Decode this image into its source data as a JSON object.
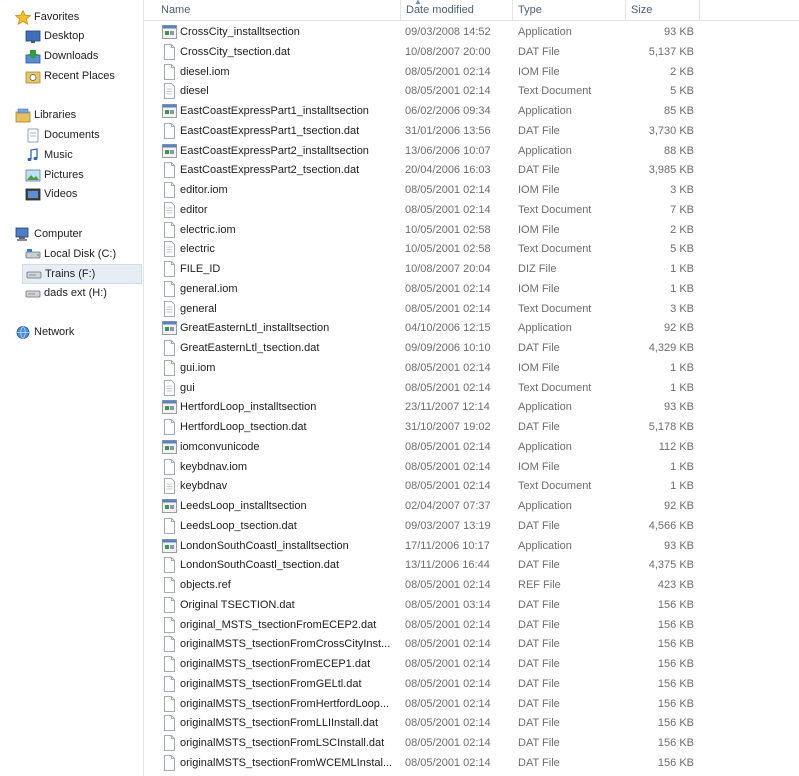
{
  "nav": {
    "favorites": "Favorites",
    "desktop": "Desktop",
    "downloads": "Downloads",
    "recent_places": "Recent Places",
    "libraries": "Libraries",
    "documents": "Documents",
    "music": "Music",
    "pictures": "Pictures",
    "videos": "Videos",
    "computer": "Computer",
    "local_disk": "Local Disk (C:)",
    "trains": "Trains (F:)",
    "dads_ext": "dads ext (H:)",
    "network": "Network"
  },
  "columns": {
    "name": "Name",
    "date": "Date modified",
    "type": "Type",
    "size": "Size"
  },
  "colors": {
    "selected_bg": "#e6edf5",
    "header_text": "#4c607a",
    "meta_text": "#6d6d6d"
  },
  "files": [
    {
      "name": "CrossCity_installtsection",
      "date": "09/03/2008 14:52",
      "type": "Application",
      "size": "93 KB",
      "icon": "application-icon"
    },
    {
      "name": "CrossCity_tsection.dat",
      "date": "10/08/2007 20:00",
      "type": "DAT File",
      "size": "5,137 KB",
      "icon": "file-icon"
    },
    {
      "name": "diesel.iom",
      "date": "08/05/2001 02:14",
      "type": "IOM File",
      "size": "2 KB",
      "icon": "file-icon"
    },
    {
      "name": "diesel",
      "date": "08/05/2001 02:14",
      "type": "Text Document",
      "size": "5 KB",
      "icon": "text-document-icon"
    },
    {
      "name": "EastCoastExpressPart1_installtsection",
      "date": "06/02/2006 09:34",
      "type": "Application",
      "size": "85 KB",
      "icon": "application-icon"
    },
    {
      "name": "EastCoastExpressPart1_tsection.dat",
      "date": "31/01/2006 13:56",
      "type": "DAT File",
      "size": "3,730 KB",
      "icon": "file-icon"
    },
    {
      "name": "EastCoastExpressPart2_installtsection",
      "date": "13/06/2006 10:07",
      "type": "Application",
      "size": "88 KB",
      "icon": "application-icon"
    },
    {
      "name": "EastCoastExpressPart2_tsection.dat",
      "date": "20/04/2006 16:03",
      "type": "DAT File",
      "size": "3,985 KB",
      "icon": "file-icon"
    },
    {
      "name": "editor.iom",
      "date": "08/05/2001 02:14",
      "type": "IOM File",
      "size": "3 KB",
      "icon": "file-icon"
    },
    {
      "name": "editor",
      "date": "08/05/2001 02:14",
      "type": "Text Document",
      "size": "7 KB",
      "icon": "text-document-icon"
    },
    {
      "name": "electric.iom",
      "date": "10/05/2001 02:58",
      "type": "IOM File",
      "size": "2 KB",
      "icon": "file-icon"
    },
    {
      "name": "electric",
      "date": "10/05/2001 02:58",
      "type": "Text Document",
      "size": "5 KB",
      "icon": "text-document-icon"
    },
    {
      "name": "FILE_ID",
      "date": "10/08/2007 20:04",
      "type": "DIZ File",
      "size": "1 KB",
      "icon": "file-icon"
    },
    {
      "name": "general.iom",
      "date": "08/05/2001 02:14",
      "type": "IOM File",
      "size": "1 KB",
      "icon": "file-icon"
    },
    {
      "name": "general",
      "date": "08/05/2001 02:14",
      "type": "Text Document",
      "size": "3 KB",
      "icon": "text-document-icon"
    },
    {
      "name": "GreatEasternLtl_installtsection",
      "date": "04/10/2006 12:15",
      "type": "Application",
      "size": "92 KB",
      "icon": "application-icon"
    },
    {
      "name": "GreatEasternLtl_tsection.dat",
      "date": "09/09/2006 10:10",
      "type": "DAT File",
      "size": "4,329 KB",
      "icon": "file-icon"
    },
    {
      "name": "gui.iom",
      "date": "08/05/2001 02:14",
      "type": "IOM File",
      "size": "1 KB",
      "icon": "file-icon"
    },
    {
      "name": "gui",
      "date": "08/05/2001 02:14",
      "type": "Text Document",
      "size": "1 KB",
      "icon": "text-document-icon"
    },
    {
      "name": "HertfordLoop_installtsection",
      "date": "23/11/2007 12:14",
      "type": "Application",
      "size": "93 KB",
      "icon": "application-icon"
    },
    {
      "name": "HertfordLoop_tsection.dat",
      "date": "31/10/2007 19:02",
      "type": "DAT File",
      "size": "5,178 KB",
      "icon": "file-icon"
    },
    {
      "name": "iomconvunicode",
      "date": "08/05/2001 02:14",
      "type": "Application",
      "size": "112 KB",
      "icon": "application-icon"
    },
    {
      "name": "keybdnav.iom",
      "date": "08/05/2001 02:14",
      "type": "IOM File",
      "size": "1 KB",
      "icon": "file-icon"
    },
    {
      "name": "keybdnav",
      "date": "08/05/2001 02:14",
      "type": "Text Document",
      "size": "1 KB",
      "icon": "text-document-icon"
    },
    {
      "name": "LeedsLoop_installtsection",
      "date": "02/04/2007 07:37",
      "type": "Application",
      "size": "92 KB",
      "icon": "application-icon"
    },
    {
      "name": "LeedsLoop_tsection.dat",
      "date": "09/03/2007 13:19",
      "type": "DAT File",
      "size": "4,566 KB",
      "icon": "file-icon"
    },
    {
      "name": "LondonSouthCoastl_installtsection",
      "date": "17/11/2006 10:17",
      "type": "Application",
      "size": "93 KB",
      "icon": "application-icon"
    },
    {
      "name": "LondonSouthCoastl_tsection.dat",
      "date": "13/11/2006 16:44",
      "type": "DAT File",
      "size": "4,375 KB",
      "icon": "file-icon"
    },
    {
      "name": "objects.ref",
      "date": "08/05/2001 02:14",
      "type": "REF File",
      "size": "423 KB",
      "icon": "file-icon"
    },
    {
      "name": "Original TSECTION.dat",
      "date": "08/05/2001 03:14",
      "type": "DAT File",
      "size": "156 KB",
      "icon": "file-icon"
    },
    {
      "name": "original_MSTS_tsectionFromECEP2.dat",
      "date": "08/05/2001 02:14",
      "type": "DAT File",
      "size": "156 KB",
      "icon": "file-icon"
    },
    {
      "name": "originalMSTS_tsectionFromCrossCityInst...",
      "date": "08/05/2001 02:14",
      "type": "DAT File",
      "size": "156 KB",
      "icon": "file-icon"
    },
    {
      "name": "originalMSTS_tsectionFromECEP1.dat",
      "date": "08/05/2001 02:14",
      "type": "DAT File",
      "size": "156 KB",
      "icon": "file-icon"
    },
    {
      "name": "originalMSTS_tsectionFromGELtl.dat",
      "date": "08/05/2001 02:14",
      "type": "DAT File",
      "size": "156 KB",
      "icon": "file-icon"
    },
    {
      "name": "originalMSTS_tsectionFromHertfordLoop...",
      "date": "08/05/2001 02:14",
      "type": "DAT File",
      "size": "156 KB",
      "icon": "file-icon"
    },
    {
      "name": "originalMSTS_tsectionFromLLIInstall.dat",
      "date": "08/05/2001 02:14",
      "type": "DAT File",
      "size": "156 KB",
      "icon": "file-icon"
    },
    {
      "name": "originalMSTS_tsectionFromLSCInstall.dat",
      "date": "08/05/2001 02:14",
      "type": "DAT File",
      "size": "156 KB",
      "icon": "file-icon"
    },
    {
      "name": "originalMSTS_tsectionFromWCEMLInstal...",
      "date": "08/05/2001 02:14",
      "type": "DAT File",
      "size": "156 KB",
      "icon": "file-icon"
    }
  ]
}
